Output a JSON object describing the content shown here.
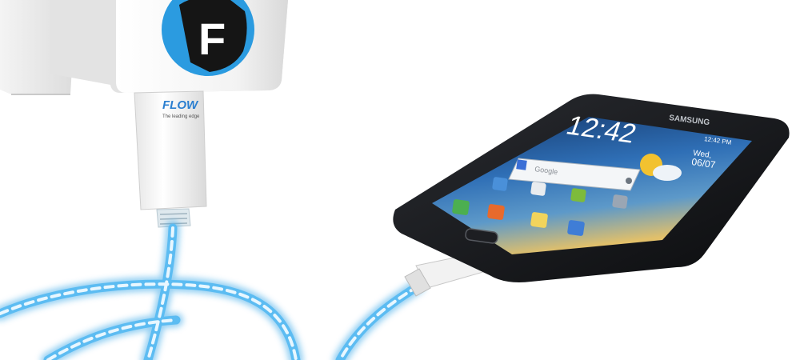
{
  "charger": {
    "logo_letter": "F",
    "plug_brand": "FLOW",
    "plug_tagline": "The leading edge"
  },
  "phone": {
    "brand": "SAMSUNG",
    "clock": "12:42",
    "status_time": "12:42 PM",
    "date_day": "Wed,",
    "date": "06/07",
    "search_placeholder": "Google"
  },
  "colors": {
    "cable_glow": "#3aa8e8",
    "cable_core": "#e8f7ff",
    "logo_blue": "#2b9be0",
    "logo_dark": "#151515",
    "phone_body": "#141518",
    "screen_sky": "#1e4f8c"
  }
}
